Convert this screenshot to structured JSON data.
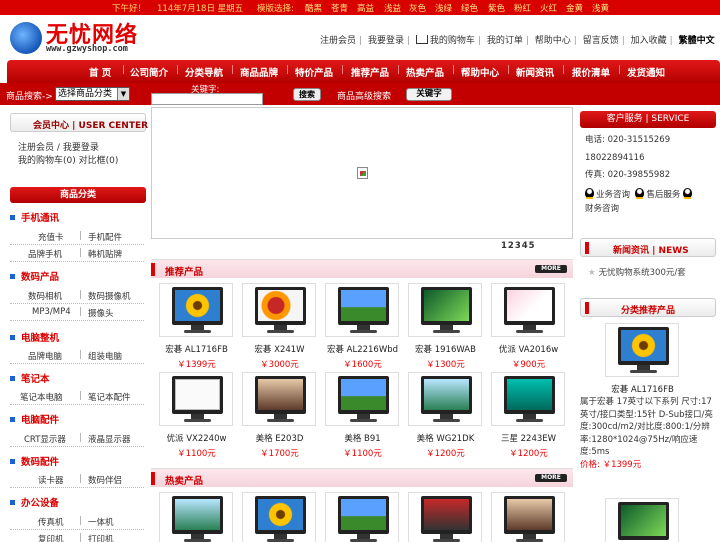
{
  "top_strip": {
    "greeting": "下午好！",
    "date": "114年7月18日 星期五",
    "skin_label": "模版选择:",
    "skins": [
      "酷黑",
      "苍青",
      "高益",
      "浅益",
      "灰色",
      "浅绿",
      "绿色",
      "紫色",
      "粉红",
      "火红",
      "金黄",
      "浅黄"
    ]
  },
  "header": {
    "logo_text": "无忧网络",
    "logo_url": "www.gzwyshop.com",
    "links": [
      "注册会员",
      "我要登录",
      "我的购物车",
      "我的订单",
      "帮助中心",
      "留言反馈",
      "加入收藏",
      "繁體中文"
    ]
  },
  "nav": {
    "items": [
      "首 页",
      "公司简介",
      "分类导航",
      "商品品牌",
      "特价产品",
      "推荐产品",
      "热卖产品",
      "帮助中心",
      "新闻资讯",
      "报价清单",
      "发货通知"
    ]
  },
  "search": {
    "label": "商品搜索->",
    "select_value": "选择商品分类",
    "keyword_label": "关键字:",
    "search_btn": "搜索",
    "advanced_link": "商品高级搜索",
    "keyword_btn": "关键字"
  },
  "user_center": {
    "title": "会员中心 | USER CENTER",
    "register": "注册会员",
    "sep": "/",
    "login": "我要登录",
    "cart_line": "我的购物车(0) 对比框(0)"
  },
  "categories": {
    "title": "商品分类",
    "groups": [
      {
        "name": "手机通讯",
        "subs": [
          [
            "充值卡",
            "手机配件"
          ],
          [
            "品牌手机",
            "韩机贴牌"
          ]
        ]
      },
      {
        "name": "数码产品",
        "subs": [
          [
            "数码相机",
            "数码摄像机"
          ],
          [
            "MP3/MP4",
            "摄像头"
          ]
        ]
      },
      {
        "name": "电脑整机",
        "subs": [
          [
            "品牌电脑",
            "组装电脑"
          ]
        ]
      },
      {
        "name": "笔记本",
        "subs": [
          [
            "笔记本电脑",
            "笔记本配件"
          ]
        ]
      },
      {
        "name": "电脑配件",
        "subs": [
          [
            "CRT显示器",
            "液晶显示器"
          ]
        ]
      },
      {
        "name": "数码配件",
        "subs": [
          [
            "读卡器",
            "数码伴侣"
          ]
        ]
      },
      {
        "name": "办公设备",
        "subs": [
          [
            "传真机",
            "一体机"
          ],
          [
            "复印机",
            "打印机"
          ]
        ]
      }
    ]
  },
  "banner": {
    "pager": "12345"
  },
  "recommended": {
    "title": "推荐产品",
    "more": "MORE",
    "products": [
      {
        "name": "宏碁 AL1716FB",
        "price": "￥1399元",
        "screen": "flower"
      },
      {
        "name": "宏碁 X241W",
        "price": "￥3000元",
        "screen": "food"
      },
      {
        "name": "宏碁 AL2216Wbd",
        "price": "￥1600元",
        "screen": "sky"
      },
      {
        "name": "宏碁 1916WAB",
        "price": "￥1300元",
        "screen": "green"
      },
      {
        "name": "优派 VA2016w",
        "price": "￥900元",
        "screen": "pink"
      },
      {
        "name": "优派 VX2240w",
        "price": "￥1100元",
        "screen": "white"
      },
      {
        "name": "美格 E203D",
        "price": "￥1700元",
        "screen": "lady"
      },
      {
        "name": "美格 B91",
        "price": "￥1100元",
        "screen": "sky"
      },
      {
        "name": "美格 WG21DK",
        "price": "￥1200元",
        "screen": "water"
      },
      {
        "name": "三星 2243EW",
        "price": "￥1200元",
        "screen": "teal"
      }
    ]
  },
  "hot": {
    "title": "热卖产品",
    "more": "MORE",
    "screens": [
      "water",
      "flower",
      "sky",
      "red",
      "lady"
    ]
  },
  "service": {
    "title": "客户服务 | SERVICE",
    "phone": "电话: 020-31515269",
    "mobile": "18022894116",
    "fax": "传真: 020-39855982",
    "qq1": "业务咨询",
    "qq2": "售后服务",
    "qq3": "财务咨询"
  },
  "news": {
    "title": "新闻资讯 | NEWS",
    "item": "无忧购物系统300元/套"
  },
  "cat_recommend": {
    "title": "分类推荐产品",
    "product_name": "宏碁 AL1716FB",
    "desc": "属于宏碁 17英寸以下系列 尺寸:17英寸/接口类型:15针 D-Sub接口/亮度:300cd/m2/对比度:800:1/分辨率:1280*1024@75Hz/响应速度:5ms",
    "price": "价格: ￥1399元"
  },
  "colors": {
    "brand_red": "#d90000",
    "price_red": "#e00000",
    "link_blue": "#1a63d6"
  }
}
